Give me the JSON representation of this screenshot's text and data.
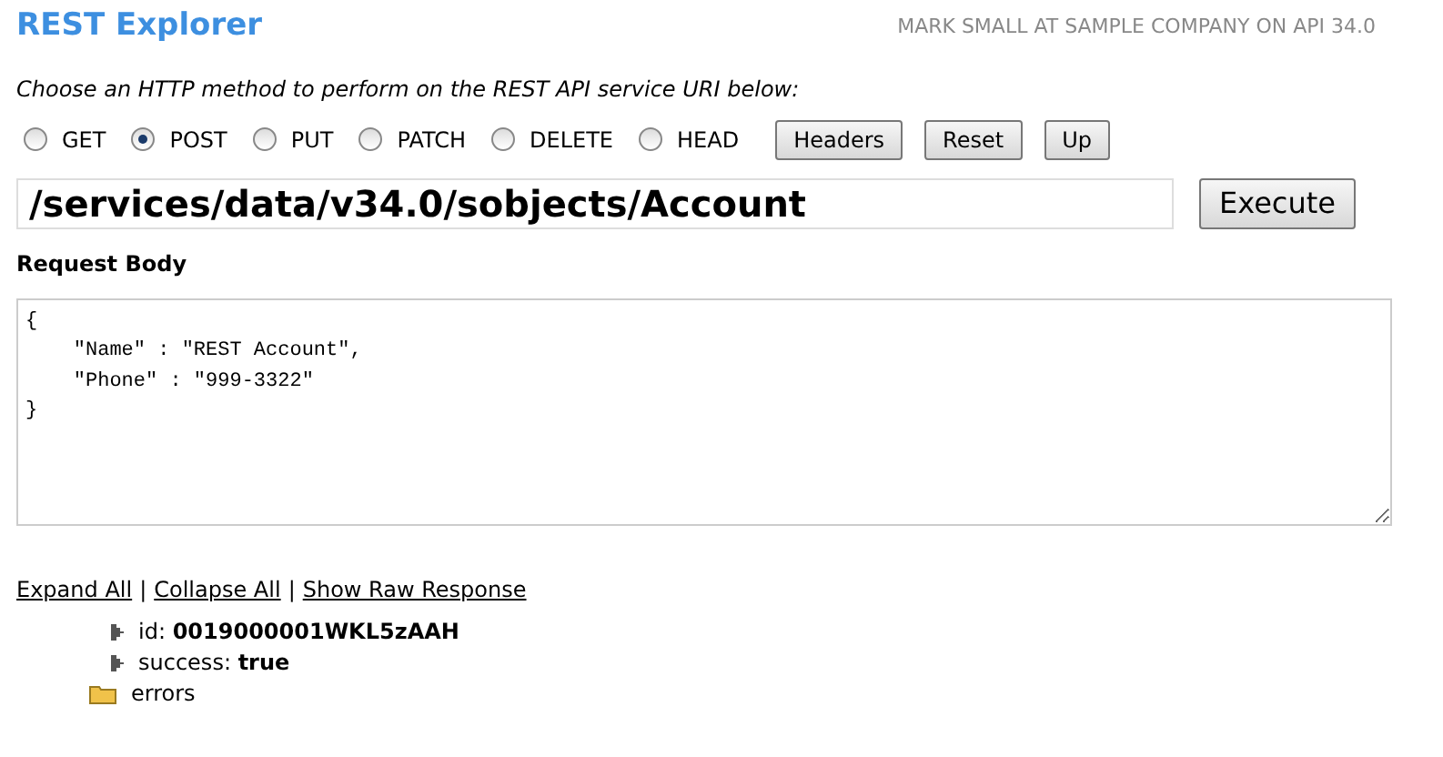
{
  "header": {
    "title": "REST Explorer",
    "user": "MARK SMALL AT SAMPLE COMPANY ON API 34.0"
  },
  "instruction": "Choose an HTTP method to perform on the REST API service URI below:",
  "methods": [
    {
      "label": "GET",
      "selected": false
    },
    {
      "label": "POST",
      "selected": true
    },
    {
      "label": "PUT",
      "selected": false
    },
    {
      "label": "PATCH",
      "selected": false
    },
    {
      "label": "DELETE",
      "selected": false
    },
    {
      "label": "HEAD",
      "selected": false
    }
  ],
  "buttons": [
    "Headers",
    "Reset",
    "Up"
  ],
  "uri": "/services/data/v34.0/sobjects/Account",
  "execute": "Execute",
  "request_body": {
    "label": "Request Body",
    "value": "{\n    \"Name\" : \"REST Account\",\n    \"Phone\" : \"999-3322\"\n}"
  },
  "links": {
    "separator": "|",
    "items": [
      "Expand All",
      "Collapse All",
      "Show Raw Response"
    ]
  },
  "tree": [
    {
      "kind": "leaf",
      "key": "id:",
      "value": "0019000001WKL5zAAH"
    },
    {
      "kind": "leaf",
      "key": "success:",
      "value": "true"
    },
    {
      "kind": "folder",
      "key": "errors"
    }
  ]
}
